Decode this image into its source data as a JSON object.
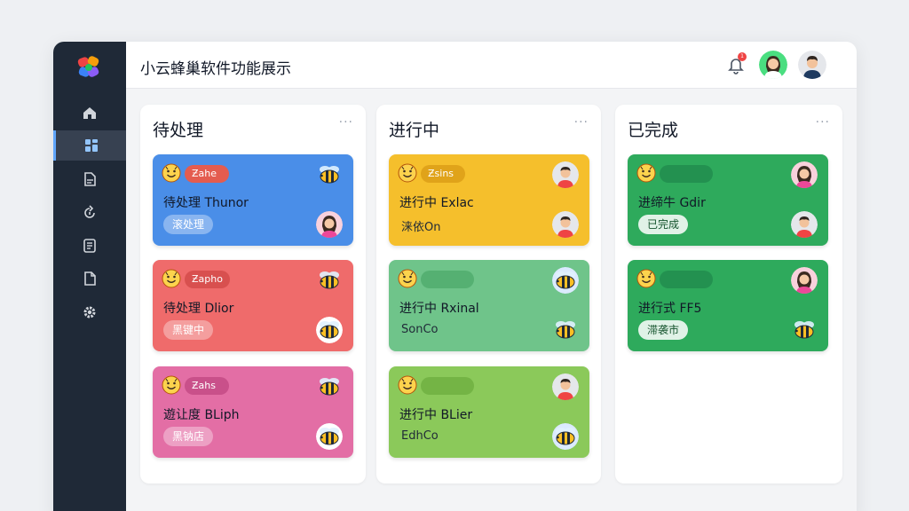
{
  "app": {
    "title": "小云蜂巢软件功能展示",
    "notification_count": "1"
  },
  "sidebar": {
    "items": [
      {
        "icon": "home-icon"
      },
      {
        "icon": "dashboard-icon",
        "active": true
      },
      {
        "icon": "document-icon"
      },
      {
        "icon": "refresh-icon"
      },
      {
        "icon": "list-icon"
      },
      {
        "icon": "file-icon"
      },
      {
        "icon": "gear-icon"
      }
    ]
  },
  "columns": [
    {
      "title": "待处理",
      "more": "···",
      "cards": [
        {
          "color": "#4a8ee8",
          "tag": "Ƶahe",
          "tag_color": "#e45c4f",
          "title": "待处理 Thunor",
          "pill": "滚处理",
          "pill_style": "light",
          "icon_top": "bee",
          "icon_bottom": "woman"
        },
        {
          "color": "#ef6b6b",
          "tag": "Ƶapho",
          "tag_color": "#d8504f",
          "title": "待处理 Dlior",
          "pill": "黑键中",
          "pill_style": "light",
          "icon_top": "bee",
          "icon_bottom": "bee-badge"
        },
        {
          "color": "#e36ea5",
          "tag": "Ƶahs",
          "tag_color": "#c9508a",
          "title": "遊让度 BLiph",
          "pill": "黑钠店",
          "pill_style": "light",
          "icon_top": "bee",
          "icon_bottom": "bee-badge"
        }
      ]
    },
    {
      "title": "进行中",
      "more": "···",
      "cards": [
        {
          "color": "#f5bf2c",
          "tag": "Ƶsins",
          "tag_color": "#e0a31a",
          "title": "进行中 Exlac",
          "plain": "涞依On",
          "icon_top": "man",
          "icon_bottom": "man"
        },
        {
          "color": "#6fc48a",
          "tag": "",
          "tag_color": "#55b072",
          "title": "进行中 Rxinal",
          "plain": "SonCo",
          "icon_top": "bee-badge-blue",
          "icon_bottom": "bee"
        },
        {
          "color": "#8bc95a",
          "tag": "",
          "tag_color": "#74b445",
          "title": "进行中 BLier",
          "plain": "EdhCo",
          "icon_top": "man",
          "icon_bottom": "bee-badge-blue"
        }
      ]
    },
    {
      "title": "已完成",
      "more": "···",
      "cards": [
        {
          "color": "#2eaa5c",
          "tag": "",
          "tag_color": "#239150",
          "title": "进缔牛 Gdir",
          "pill": "已完成",
          "pill_style": "dark",
          "icon_top": "woman",
          "icon_bottom": "man"
        },
        {
          "color": "#2eaa5c",
          "tag": "",
          "tag_color": "#239150",
          "title": "进行式 FF5",
          "pill": "滞袭市",
          "pill_style": "dark",
          "icon_top": "woman",
          "icon_bottom": "bee"
        }
      ]
    }
  ]
}
